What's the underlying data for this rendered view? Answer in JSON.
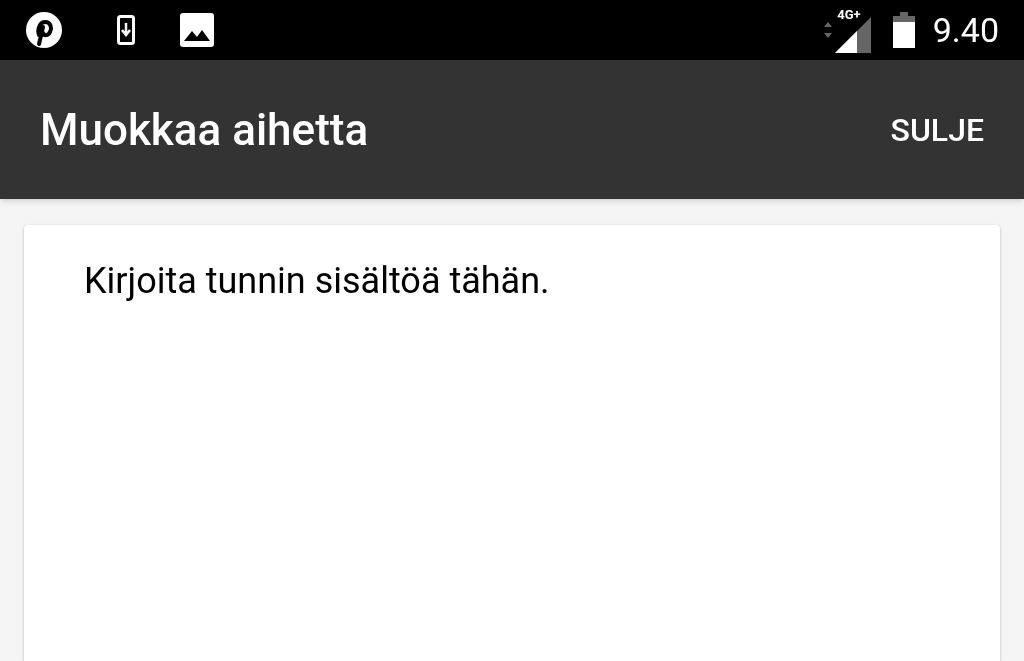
{
  "status_bar": {
    "network": "4G+",
    "time": "9.40"
  },
  "app_bar": {
    "title": "Muokkaa aihetta",
    "action": "SULJE"
  },
  "editor": {
    "placeholder": "Kirjoita tunnin sisältöä tähän."
  }
}
